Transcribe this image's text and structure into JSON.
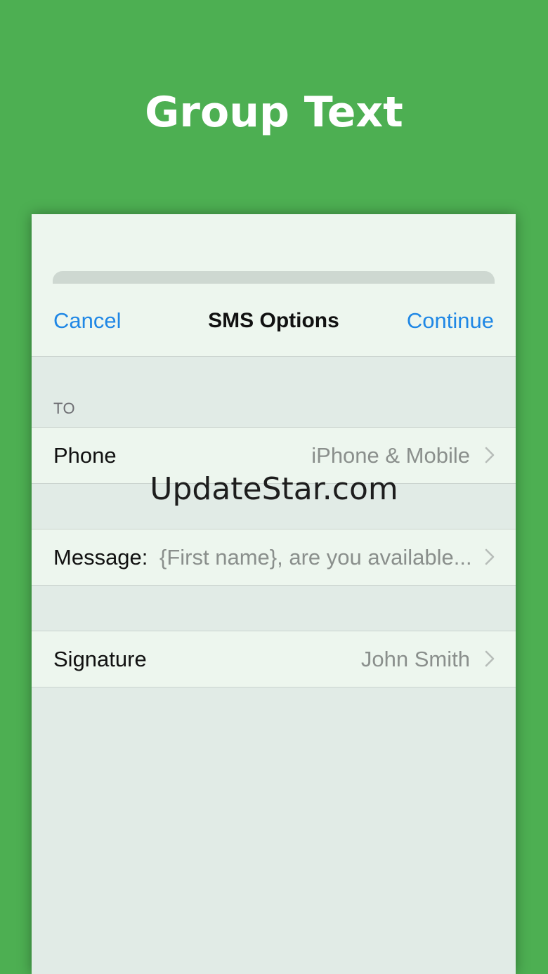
{
  "promo": {
    "title": "Group Text"
  },
  "nav": {
    "cancel_label": "Cancel",
    "title": "SMS Options",
    "continue_label": "Continue"
  },
  "section": {
    "header": "TO"
  },
  "cells": {
    "phone": {
      "label": "Phone",
      "value": "iPhone & Mobile",
      "icon": "chevron-right-icon"
    },
    "message": {
      "label": "Message:",
      "value": "{First name}, are you available...",
      "icon": "chevron-right-icon"
    },
    "signature": {
      "label": "Signature",
      "value": "John Smith",
      "icon": "chevron-right-icon"
    }
  },
  "watermark": "UpdateStar.com",
  "colors": {
    "background": "#4daf52",
    "accent": "#1f87e5",
    "secondary_text": "#8a8f8c"
  }
}
